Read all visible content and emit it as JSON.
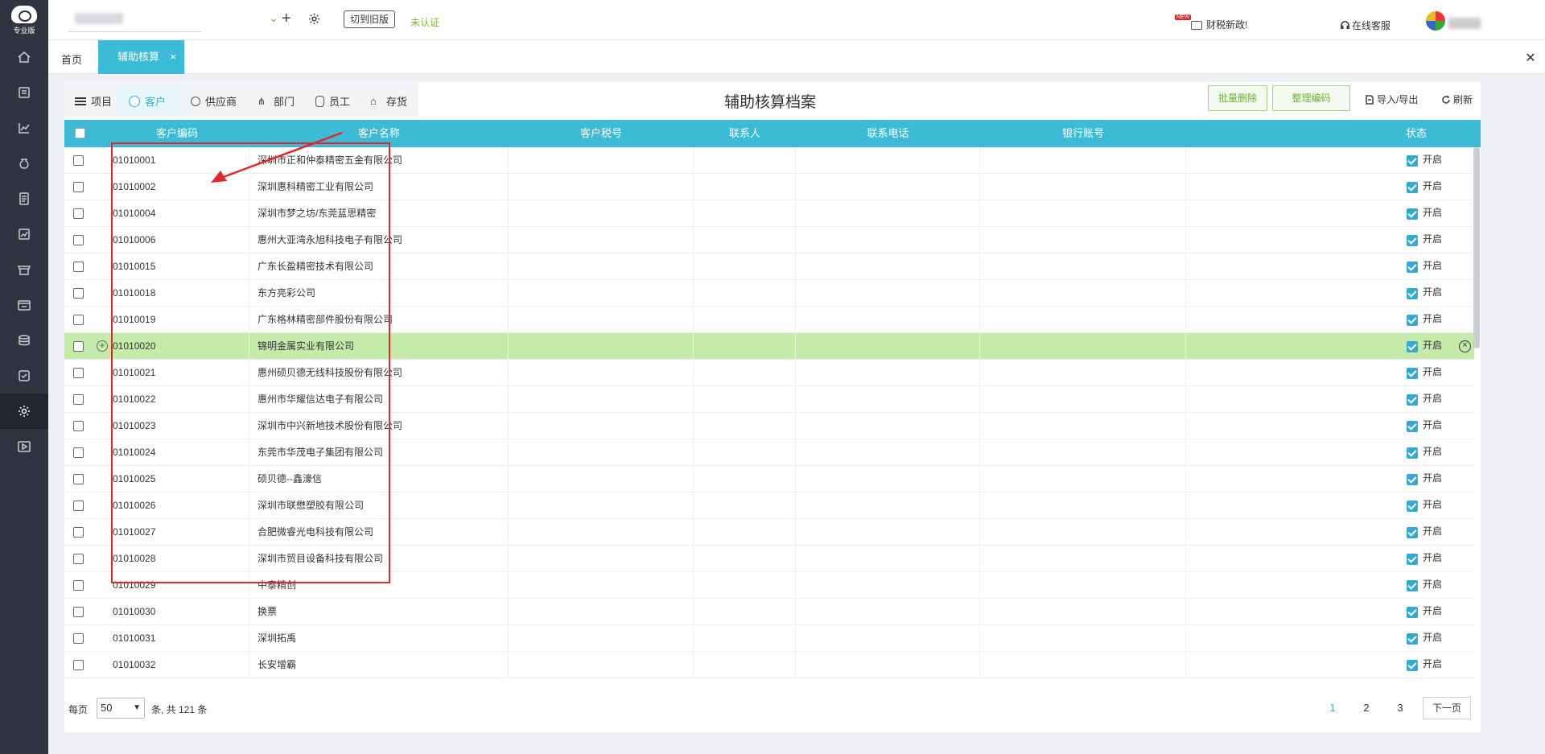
{
  "app": {
    "logo_text": "专业版"
  },
  "sidebar": {
    "items": [
      {
        "icon": "home-icon"
      },
      {
        "icon": "voucher-icon"
      },
      {
        "icon": "chart-icon"
      },
      {
        "icon": "money-bag-icon"
      },
      {
        "icon": "ledger-icon"
      },
      {
        "icon": "report-icon"
      },
      {
        "icon": "store-icon"
      },
      {
        "icon": "invoice-icon"
      },
      {
        "icon": "coins-icon"
      },
      {
        "icon": "tax-icon"
      },
      {
        "icon": "settings-icon"
      },
      {
        "icon": "video-icon"
      }
    ],
    "active_index": 10
  },
  "topbar": {
    "switch_old": "切到旧版",
    "unverified": "未认证",
    "news_badge": "NEW",
    "news": "财税新政!",
    "service": "在线客服"
  },
  "tabs": {
    "home": "首页",
    "active": "辅助核算",
    "close": "×"
  },
  "window_close": "✕",
  "categories": [
    {
      "label": "项目"
    },
    {
      "label": "客户"
    },
    {
      "label": "供应商"
    },
    {
      "label": "部门"
    },
    {
      "label": "员工"
    },
    {
      "label": "存货"
    }
  ],
  "page_title": "辅助核算档案",
  "toolbar": {
    "batch_delete": "批量删除",
    "reorganize_code": "整理编码",
    "import_export": "导入/导出",
    "refresh": "刷新"
  },
  "table": {
    "headers": [
      "客户编码",
      "客户名称",
      "客户税号",
      "联系人",
      "联系电话",
      "银行账号",
      "状态"
    ],
    "status_label": "开启",
    "add_symbol": "+",
    "delete_symbol": "×",
    "rows": [
      {
        "code": "01010001",
        "name": "深圳市正和仲泰精密五金有限公司"
      },
      {
        "code": "01010002",
        "name": "深圳惠科精密工业有限公司"
      },
      {
        "code": "01010004",
        "name": "深圳市梦之坊/东莞蓝思精密"
      },
      {
        "code": "01010006",
        "name": "惠州大亚湾永旭科技电子有限公司"
      },
      {
        "code": "01010015",
        "name": "广东长盈精密技术有限公司"
      },
      {
        "code": "01010018",
        "name": "东方亮彩公司"
      },
      {
        "code": "01010019",
        "name": "广东格林精密部件股份有限公司"
      },
      {
        "code": "01010020",
        "name": "锦明金属实业有限公司",
        "highlighted": true
      },
      {
        "code": "01010021",
        "name": "惠州硕贝德无线科技股份有限公司"
      },
      {
        "code": "01010022",
        "name": "惠州市华耀信达电子有限公司"
      },
      {
        "code": "01010023",
        "name": "深圳市中兴新地技术股份有限公司"
      },
      {
        "code": "01010024",
        "name": "东莞市华茂电子集团有限公司"
      },
      {
        "code": "01010025",
        "name": "硕贝德--鑫濠信"
      },
      {
        "code": "01010026",
        "name": "深圳市联懋塑胶有限公司"
      },
      {
        "code": "01010027",
        "name": "合肥微睿光电科技有限公司"
      },
      {
        "code": "01010028",
        "name": "深圳市贸目设备科技有限公司"
      },
      {
        "code": "01010029",
        "name": "中泰精创"
      },
      {
        "code": "01010030",
        "name": "换票"
      },
      {
        "code": "01010031",
        "name": "深圳拓禹"
      },
      {
        "code": "01010032",
        "name": "长安增霸"
      }
    ]
  },
  "pagination": {
    "per_page_label": "每页",
    "per_page": "50",
    "total_text": "条, 共 121 条",
    "pages": [
      "1",
      "2",
      "3"
    ],
    "current": "1",
    "next": "下一页"
  },
  "colors": {
    "accent": "#3cbbd6",
    "highlight_row": "#c5ebaa",
    "sidebar": "#2f3440",
    "annotation": "#e3282b"
  }
}
